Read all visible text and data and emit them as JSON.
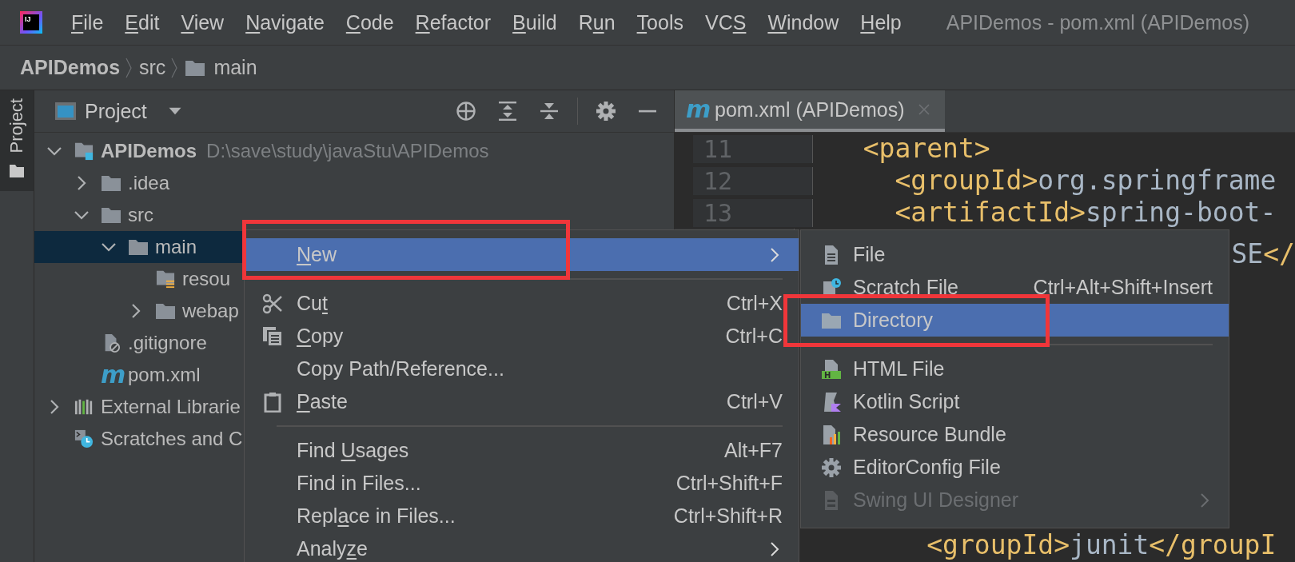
{
  "window": {
    "logo_text": "IJ",
    "title": "APIDemos - pom.xml (APIDemos)"
  },
  "menu_bar": [
    {
      "key": "F",
      "rest": "ile"
    },
    {
      "key": "E",
      "rest": "dit"
    },
    {
      "key": "V",
      "rest": "iew"
    },
    {
      "key": "N",
      "rest": "avigate"
    },
    {
      "key": "C",
      "rest": "ode"
    },
    {
      "key": "R",
      "rest": "efactor"
    },
    {
      "key": "B",
      "rest": "uild"
    },
    {
      "pre": "R",
      "key": "u",
      "rest": "n"
    },
    {
      "key": "T",
      "rest": "ools"
    },
    {
      "pre": "VC",
      "key": "S"
    },
    {
      "key": "W",
      "rest": "indow"
    },
    {
      "key": "H",
      "rest": "elp"
    }
  ],
  "breadcrumb": [
    {
      "label": "APIDemos",
      "kind": "project"
    },
    {
      "label": "src",
      "kind": "plain"
    },
    {
      "label": "main",
      "kind": "folder"
    }
  ],
  "tool_stripe": {
    "label": "Project",
    "selected": true
  },
  "project_panel": {
    "title": "Project",
    "tree": [
      {
        "label": "APIDemos",
        "path": "D:\\save\\study\\javaStu\\APIDemos",
        "kind": "module",
        "expanded": true,
        "selected": false,
        "children": [
          {
            "label": ".idea",
            "kind": "folder",
            "expanded": false,
            "selected": false
          },
          {
            "label": "src",
            "kind": "folder",
            "expanded": true,
            "selected": false,
            "children": [
              {
                "label": "main",
                "kind": "folder",
                "expanded": true,
                "selected": true,
                "children": [
                  {
                    "label": "resou",
                    "kind": "resources",
                    "selected": false
                  },
                  {
                    "label": "webap",
                    "kind": "folder",
                    "expanded": false,
                    "selected": false
                  }
                ]
              }
            ]
          },
          {
            "label": ".gitignore",
            "kind": "ignore",
            "selected": false
          },
          {
            "label": "pom.xml",
            "kind": "maven",
            "icon_text": "m",
            "selected": false
          }
        ]
      },
      {
        "label": "External Librarie",
        "kind": "libraries",
        "expanded": false,
        "selected": false
      },
      {
        "label": "Scratches and C",
        "kind": "scratches",
        "selected": false
      }
    ]
  },
  "editor": {
    "tab": {
      "label": "pom.xml (APIDemos)",
      "icon_text": "m",
      "selected": true
    },
    "lines": [
      {
        "kind": "code",
        "number": "11",
        "segments": [
          {
            "kind": "tag",
            "text": "  <parent>"
          }
        ]
      },
      {
        "kind": "code",
        "number": "12",
        "segments": [
          {
            "kind": "tag",
            "text": "    <groupId>"
          },
          {
            "kind": "text",
            "text": "org.springframe"
          }
        ]
      },
      {
        "kind": "code",
        "number": "13",
        "segments": [
          {
            "kind": "tag",
            "text": "    <artifactId>"
          },
          {
            "kind": "text",
            "text": "spring-boot-"
          }
        ]
      },
      {
        "kind": "right",
        "segments": [
          {
            "kind": "text",
            "text": "SE"
          },
          {
            "kind": "tag",
            "text": "</"
          }
        ]
      },
      {
        "kind": "blank"
      },
      {
        "kind": "blank"
      },
      {
        "kind": "blank"
      },
      {
        "kind": "blank"
      },
      {
        "kind": "code",
        "segments": [
          {
            "kind": "tag",
            "text": "      <groupId>"
          },
          {
            "kind": "text",
            "text": "junit"
          },
          {
            "kind": "tag",
            "text": "</groupI"
          }
        ]
      }
    ]
  },
  "context_menu": {
    "items": [
      {
        "kind": "submenu",
        "key": "N",
        "rest": "ew",
        "selected": true,
        "annotated": true
      },
      {
        "kind": "separator"
      },
      {
        "kind": "cut",
        "pre": "Cu",
        "key": "t",
        "shortcut": "Ctrl+X",
        "selected": false,
        "annotated": false
      },
      {
        "kind": "copy",
        "key": "C",
        "rest": "opy",
        "shortcut": "Ctrl+C",
        "selected": false,
        "annotated": false
      },
      {
        "kind": "plain",
        "rest": "Copy Path/Reference...",
        "selected": false,
        "annotated": false
      },
      {
        "kind": "paste",
        "key": "P",
        "rest": "aste",
        "shortcut": "Ctrl+V",
        "selected": false,
        "annotated": false
      },
      {
        "kind": "separator"
      },
      {
        "kind": "plain",
        "pre": "Find ",
        "key": "U",
        "rest": "sages",
        "shortcut": "Alt+F7",
        "selected": false,
        "annotated": false
      },
      {
        "kind": "plain",
        "rest": "Find in Files...",
        "shortcut": "Ctrl+Shift+F",
        "selected": false,
        "annotated": false
      },
      {
        "kind": "plain",
        "pre": "Repl",
        "key": "a",
        "rest": "ce in Files...",
        "shortcut": "Ctrl+Shift+R",
        "selected": false,
        "annotated": false
      },
      {
        "kind": "submenu",
        "pre": "Analy",
        "key": "z",
        "rest": "e",
        "selected": false,
        "annotated": false
      }
    ]
  },
  "submenu": {
    "items": [
      {
        "kind": "file",
        "label": "File",
        "selected": false,
        "disabled": false,
        "annotated": false
      },
      {
        "kind": "scratch",
        "label": "Scratch File",
        "shortcut": "Ctrl+Alt+Shift+Insert",
        "selected": false,
        "disabled": false,
        "annotated": false
      },
      {
        "kind": "directory",
        "label": "Directory",
        "selected": true,
        "disabled": false,
        "annotated": true
      },
      {
        "kind": "separator"
      },
      {
        "kind": "html",
        "label": "HTML File",
        "icon_text": "H",
        "selected": false,
        "disabled": false,
        "annotated": false
      },
      {
        "kind": "kotlin",
        "label": "Kotlin Script",
        "selected": false,
        "disabled": false,
        "annotated": false
      },
      {
        "kind": "bundle",
        "label": "Resource Bundle",
        "selected": false,
        "disabled": false,
        "annotated": false
      },
      {
        "kind": "gear",
        "label": "EditorConfig File",
        "selected": false,
        "disabled": false,
        "annotated": false
      },
      {
        "kind": "swing",
        "label": "Swing UI Designer",
        "selected": false,
        "disabled": true,
        "annotated": false,
        "submenu": true
      }
    ]
  }
}
